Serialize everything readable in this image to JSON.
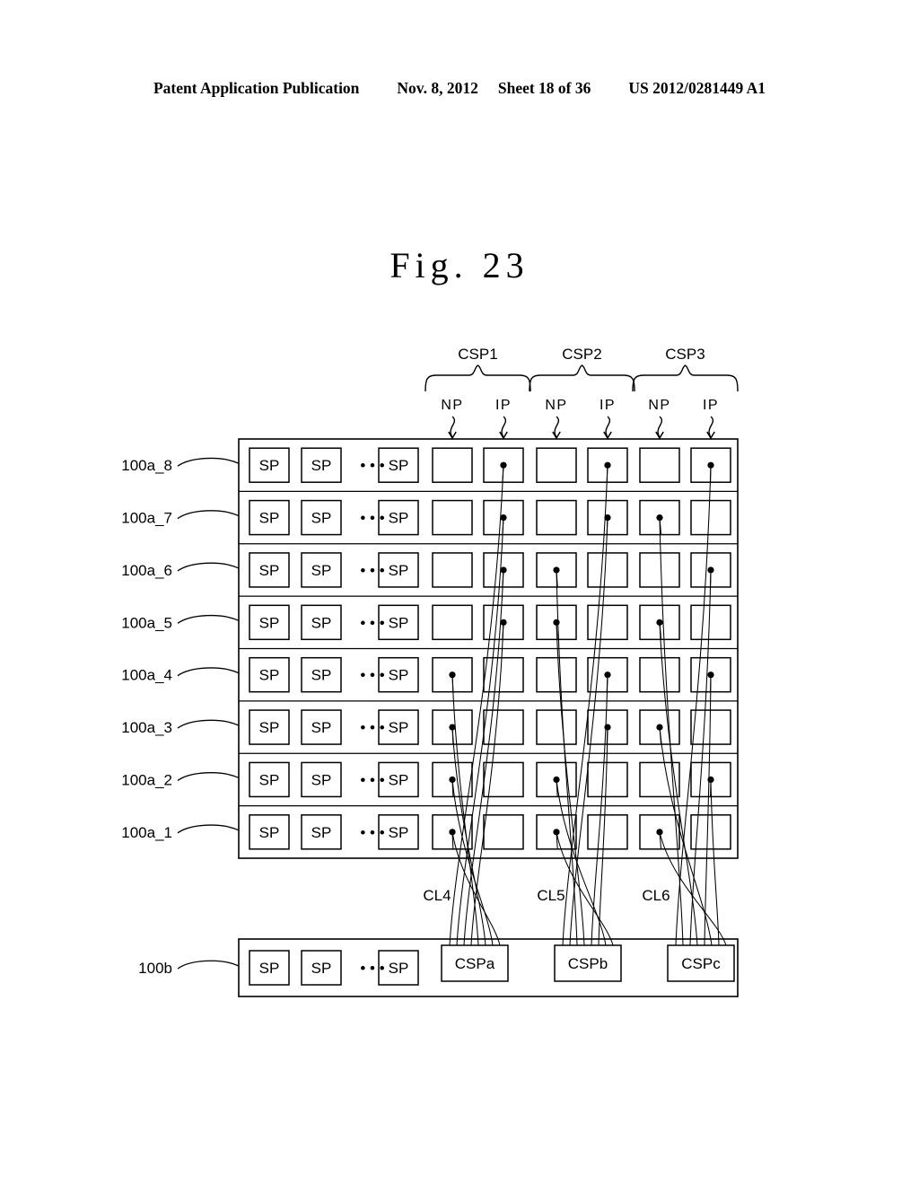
{
  "header": {
    "title": "Patent Application Publication",
    "date": "Nov. 8, 2012",
    "sheet": "Sheet 18 of 36",
    "number": "US 2012/0281449 A1"
  },
  "figure": {
    "title": "Fig. 23",
    "caption_label": "Fig.",
    "caption_number": "23"
  },
  "top_groups": [
    {
      "name": "CSP1",
      "pins": [
        "NP",
        "IP"
      ]
    },
    {
      "name": "CSP2",
      "pins": [
        "NP",
        "IP"
      ]
    },
    {
      "name": "CSP3",
      "pins": [
        "NP",
        "IP"
      ]
    }
  ],
  "array_upper": {
    "label_prefix": "100a_",
    "cell_label": "SP",
    "ellipsis": "• • •",
    "sp_columns": 3,
    "pin_columns": [
      "NP1",
      "IP1",
      "NP2",
      "IP2",
      "NP3",
      "IP3"
    ],
    "rows": [
      {
        "label": "100a_8",
        "dots": [
          "IP1",
          "IP2",
          "IP3"
        ]
      },
      {
        "label": "100a_7",
        "dots": [
          "IP1",
          "IP2",
          "NP3"
        ]
      },
      {
        "label": "100a_6",
        "dots": [
          "IP1",
          "NP2",
          "IP3"
        ]
      },
      {
        "label": "100a_5",
        "dots": [
          "IP1",
          "NP2",
          "NP3"
        ]
      },
      {
        "label": "100a_4",
        "dots": [
          "NP1",
          "IP2",
          "IP3"
        ]
      },
      {
        "label": "100a_3",
        "dots": [
          "NP1",
          "IP2",
          "NP3"
        ]
      },
      {
        "label": "100a_2",
        "dots": [
          "NP1",
          "NP2",
          "IP3"
        ]
      },
      {
        "label": "100a_1",
        "dots": [
          "NP1",
          "NP2",
          "NP3"
        ]
      }
    ]
  },
  "connection_labels": [
    "CL4",
    "CL5",
    "CL6"
  ],
  "array_lower": {
    "label": "100b",
    "cell_label": "SP",
    "ellipsis": "• • •",
    "sp_columns": 3,
    "csp_cells": [
      "CSPa",
      "CSPb",
      "CSPc"
    ]
  },
  "colors": {
    "ink": "#000000",
    "paper": "#ffffff"
  }
}
